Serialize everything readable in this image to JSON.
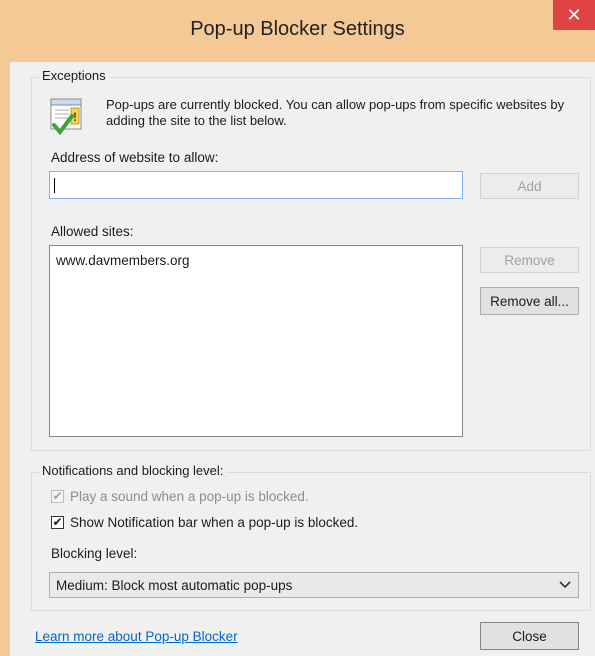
{
  "window": {
    "title": "Pop-up Blocker Settings",
    "close_glyph": "✕"
  },
  "exceptions": {
    "legend": "Exceptions",
    "info_text": "Pop-ups are currently blocked.  You can allow pop-ups from specific websites by adding the site to the list below.",
    "address_label": "Address of website to allow:",
    "address_value": "",
    "add_button": "Add",
    "allowed_label": "Allowed sites:",
    "allowed_sites": [
      "www.davmembers.org"
    ],
    "remove_button": "Remove",
    "remove_all_button": "Remove all..."
  },
  "notifications": {
    "legend": "Notifications and blocking level:",
    "play_sound_label": "Play a sound when a pop-up is blocked.",
    "play_sound_checked": true,
    "show_bar_label": "Show Notification bar when a pop-up is blocked.",
    "show_bar_checked": true,
    "blocking_level_label": "Blocking level:",
    "blocking_level_value": "Medium: Block most automatic pop-ups"
  },
  "footer": {
    "learn_more_link": "Learn more about Pop-up Blocker",
    "close_button": "Close"
  },
  "icons": {
    "info": "info-icon",
    "close": "close-icon",
    "dropdown": "chevron-down-icon",
    "check": "✔"
  },
  "colors": {
    "titlebar": "#f4c995",
    "close_button": "#e04343",
    "link": "#0066cc",
    "focus_border": "#7eb4ea"
  }
}
